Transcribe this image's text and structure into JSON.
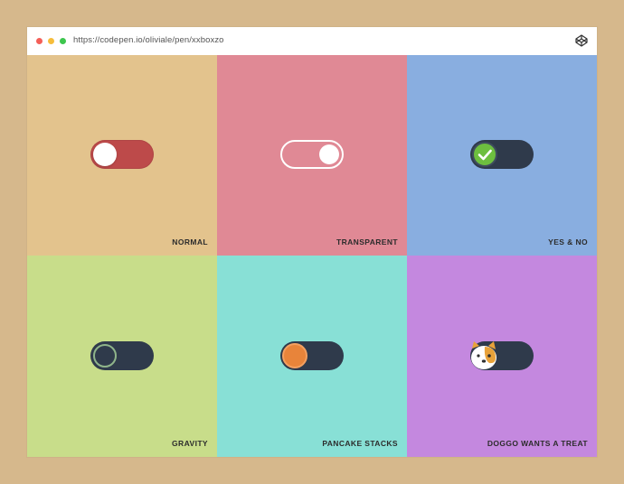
{
  "browser": {
    "url": "https://codepen.io/oliviale/pen/xxboxzo",
    "window_controls": [
      "close",
      "minimize",
      "maximize"
    ],
    "icon": "codepen-icon"
  },
  "colors": {
    "page_background": "#d6b88c",
    "normal_bg": "#e3c38d",
    "transparent_bg": "#e08995",
    "yesno_bg": "#89aee0",
    "gravity_bg": "#c8dd8a",
    "pancake_bg": "#88e0d6",
    "doggo_bg": "#c488df",
    "toggle_dark": "#2f3a4b",
    "toggle_red": "#bd4a4a"
  },
  "toggles": [
    {
      "label": "NORMAL",
      "state": "off"
    },
    {
      "label": "TRANSPARENT",
      "state": "on"
    },
    {
      "label": "YES & NO",
      "state": "yes"
    },
    {
      "label": "GRAVITY",
      "state": "off"
    },
    {
      "label": "PANCAKE STACKS",
      "state": "off"
    },
    {
      "label": "DOGGO WANTS A TREAT",
      "state": "off"
    }
  ]
}
